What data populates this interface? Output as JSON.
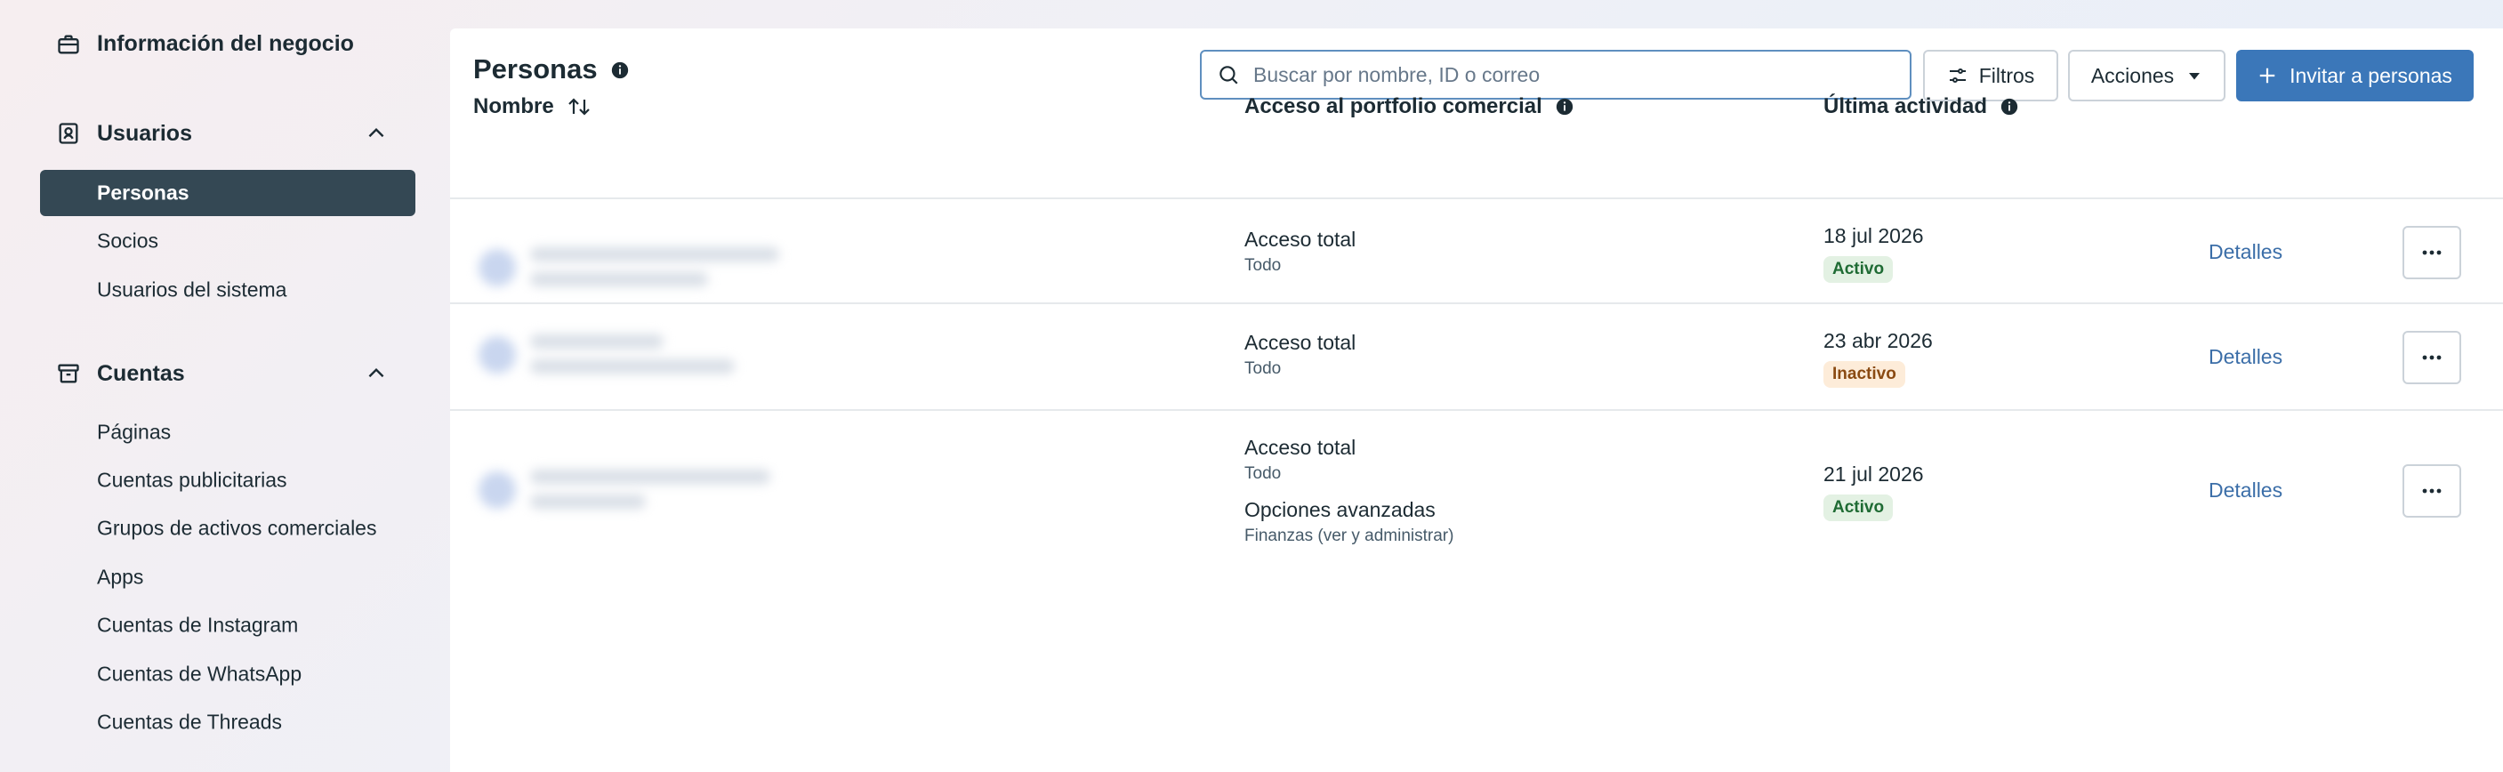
{
  "sidebar": {
    "business_info": {
      "label": "Información del negocio",
      "icon": "briefcase-icon"
    },
    "users": {
      "label": "Usuarios",
      "icon": "user-badge-icon",
      "items": [
        {
          "label": "Personas",
          "active": true
        },
        {
          "label": "Socios",
          "active": false
        },
        {
          "label": "Usuarios del sistema",
          "active": false
        }
      ]
    },
    "accounts": {
      "label": "Cuentas",
      "icon": "archive-box-icon",
      "items": [
        {
          "label": "Páginas"
        },
        {
          "label": "Cuentas publicitarias"
        },
        {
          "label": "Grupos de activos comerciales"
        },
        {
          "label": "Apps"
        },
        {
          "label": "Cuentas de Instagram"
        },
        {
          "label": "Cuentas de WhatsApp"
        },
        {
          "label": "Cuentas de Threads"
        }
      ]
    }
  },
  "header": {
    "title": "Personas",
    "search_placeholder": "Buscar por nombre, ID o correo",
    "filters_label": "Filtros",
    "actions_label": "Acciones",
    "invite_label": "Invitar a personas"
  },
  "table": {
    "columns": {
      "name": "Nombre",
      "access": "Acceso al portfolio comercial",
      "activity": "Última actividad"
    },
    "rows": [
      {
        "access": [
          {
            "title": "Acceso total",
            "detail": "Todo"
          }
        ],
        "date": "18 jul 2026",
        "status": "Activo",
        "status_type": "active",
        "details_label": "Detalles"
      },
      {
        "access": [
          {
            "title": "Acceso total",
            "detail": "Todo"
          }
        ],
        "date": "23 abr 2026",
        "status": "Inactivo",
        "status_type": "inactive",
        "details_label": "Detalles"
      },
      {
        "access": [
          {
            "title": "Acceso total",
            "detail": "Todo"
          },
          {
            "title": "Opciones avanzadas",
            "detail": "Finanzas (ver y administrar)"
          }
        ],
        "date": "21 jul 2026",
        "status": "Activo",
        "status_type": "active",
        "details_label": "Detalles"
      }
    ]
  },
  "colors": {
    "accent": "#3b77b9",
    "active_nav": "#344854",
    "link": "#3b6ea8",
    "badge_active_bg": "#e3f1e3",
    "badge_inactive_bg": "#fdecd9"
  }
}
